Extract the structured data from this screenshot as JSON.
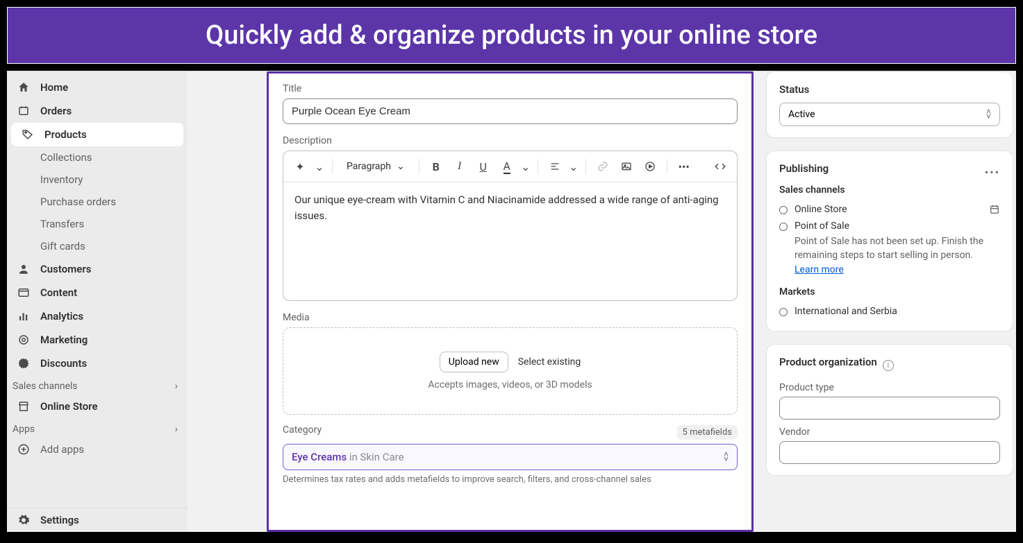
{
  "banner": "Quickly add & organize products in your online store",
  "sidebar": {
    "items": [
      {
        "label": "Home"
      },
      {
        "label": "Orders"
      },
      {
        "label": "Products"
      },
      {
        "label": "Collections"
      },
      {
        "label": "Inventory"
      },
      {
        "label": "Purchase orders"
      },
      {
        "label": "Transfers"
      },
      {
        "label": "Gift cards"
      },
      {
        "label": "Customers"
      },
      {
        "label": "Content"
      },
      {
        "label": "Analytics"
      },
      {
        "label": "Marketing"
      },
      {
        "label": "Discounts"
      }
    ],
    "sales_channels_label": "Sales channels",
    "online_store": "Online Store",
    "apps_label": "Apps",
    "add_apps": "Add apps",
    "settings": "Settings"
  },
  "form": {
    "title_label": "Title",
    "title_value": "Purple Ocean Eye Cream",
    "desc_label": "Description",
    "paragraph_label": "Paragraph",
    "desc_body": "Our unique eye-cream with Vitamin C and Niacinamide addressed a wide range of anti-aging issues.",
    "media_label": "Media",
    "upload_new": "Upload new",
    "select_existing": "Select existing",
    "media_hint": "Accepts images, videos, or 3D models",
    "category_label": "Category",
    "metafields_badge": "5 metafields",
    "category_value": "Eye Creams",
    "category_parent": " in Skin Care",
    "category_hint": "Determines tax rates and adds metafields to improve search, filters, and cross-channel sales"
  },
  "right": {
    "status_label": "Status",
    "status_value": "Active",
    "publishing_label": "Publishing",
    "sales_channels_label": "Sales channels",
    "online_store": "Online Store",
    "pos": "Point of Sale",
    "pos_hint": "Point of Sale has not been set up. Finish the remaining steps to start selling in person.",
    "learn_more": "Learn more",
    "markets_label": "Markets",
    "market_value": "International and Serbia",
    "org_label": "Product organization",
    "product_type_label": "Product type",
    "vendor_label": "Vendor"
  }
}
